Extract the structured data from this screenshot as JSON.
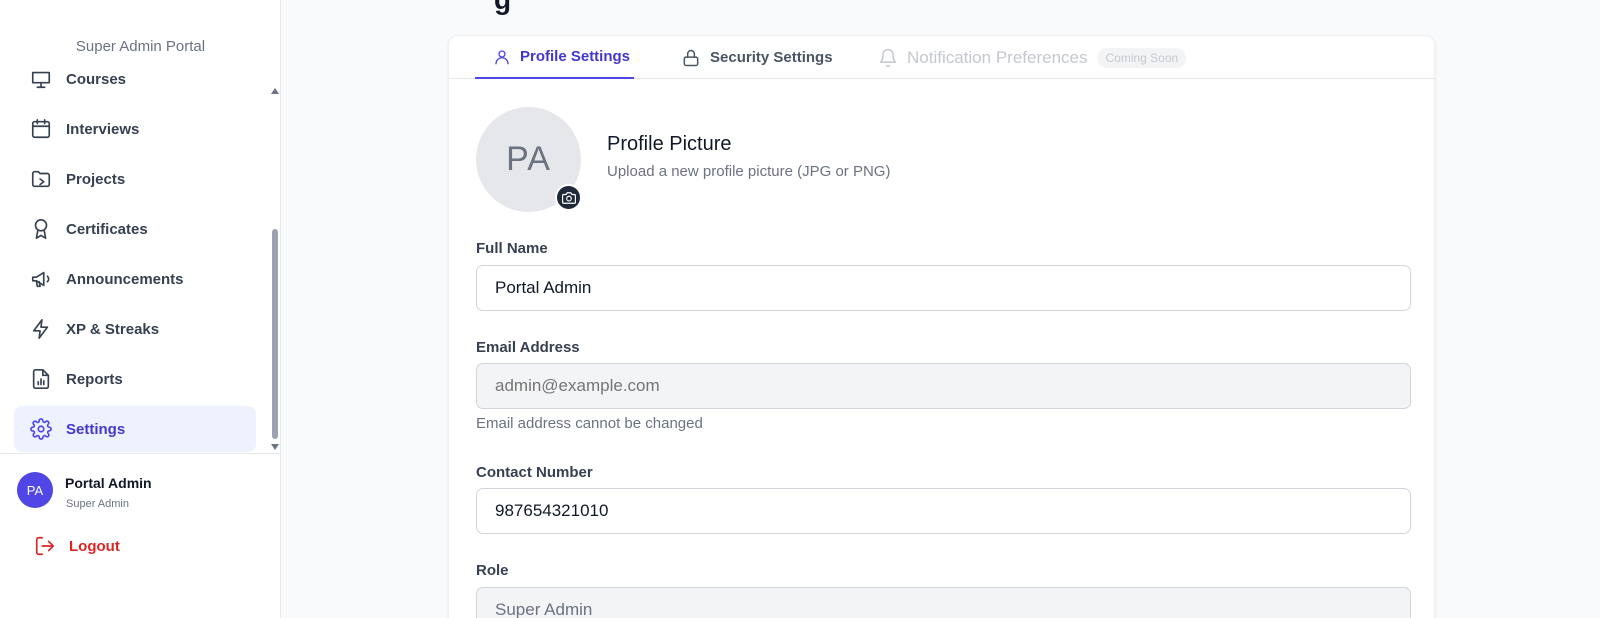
{
  "sidebar": {
    "portal_title": "Super Admin Portal",
    "items": [
      {
        "label": "Courses",
        "icon": "courses-icon"
      },
      {
        "label": "Interviews",
        "icon": "calendar-icon"
      },
      {
        "label": "Projects",
        "icon": "folder-icon"
      },
      {
        "label": "Certificates",
        "icon": "award-icon"
      },
      {
        "label": "Announcements",
        "icon": "megaphone-icon"
      },
      {
        "label": "XP & Streaks",
        "icon": "lightning-icon"
      },
      {
        "label": "Reports",
        "icon": "report-icon"
      },
      {
        "label": "Settings",
        "icon": "gear-icon"
      }
    ],
    "active_item": "Settings",
    "user": {
      "initials": "PA",
      "name": "Portal Admin",
      "role": "Super Admin"
    },
    "logout_label": "Logout"
  },
  "main": {
    "tabs": [
      {
        "label": "Profile Settings",
        "state": "active",
        "icon": "user-icon"
      },
      {
        "label": "Security Settings",
        "state": "normal",
        "icon": "lock-icon"
      },
      {
        "label": "Notification Preferences",
        "state": "disabled",
        "icon": "bell-icon",
        "badge": "Coming Soon"
      }
    ],
    "profile_picture": {
      "initials": "PA",
      "title": "Profile Picture",
      "subtitle": "Upload a new profile picture (JPG or PNG)"
    },
    "fields": {
      "full_name": {
        "label": "Full Name",
        "value": "Portal Admin"
      },
      "email": {
        "label": "Email Address",
        "placeholder": "admin@example.com",
        "hint": "Email address cannot be changed"
      },
      "contact": {
        "label": "Contact Number",
        "value": "987654321010"
      },
      "role": {
        "label": "Role",
        "value": "Super Admin"
      }
    }
  },
  "colors": {
    "accent": "#4f46e5",
    "danger": "#dc2626",
    "muted": "#6b7280"
  }
}
